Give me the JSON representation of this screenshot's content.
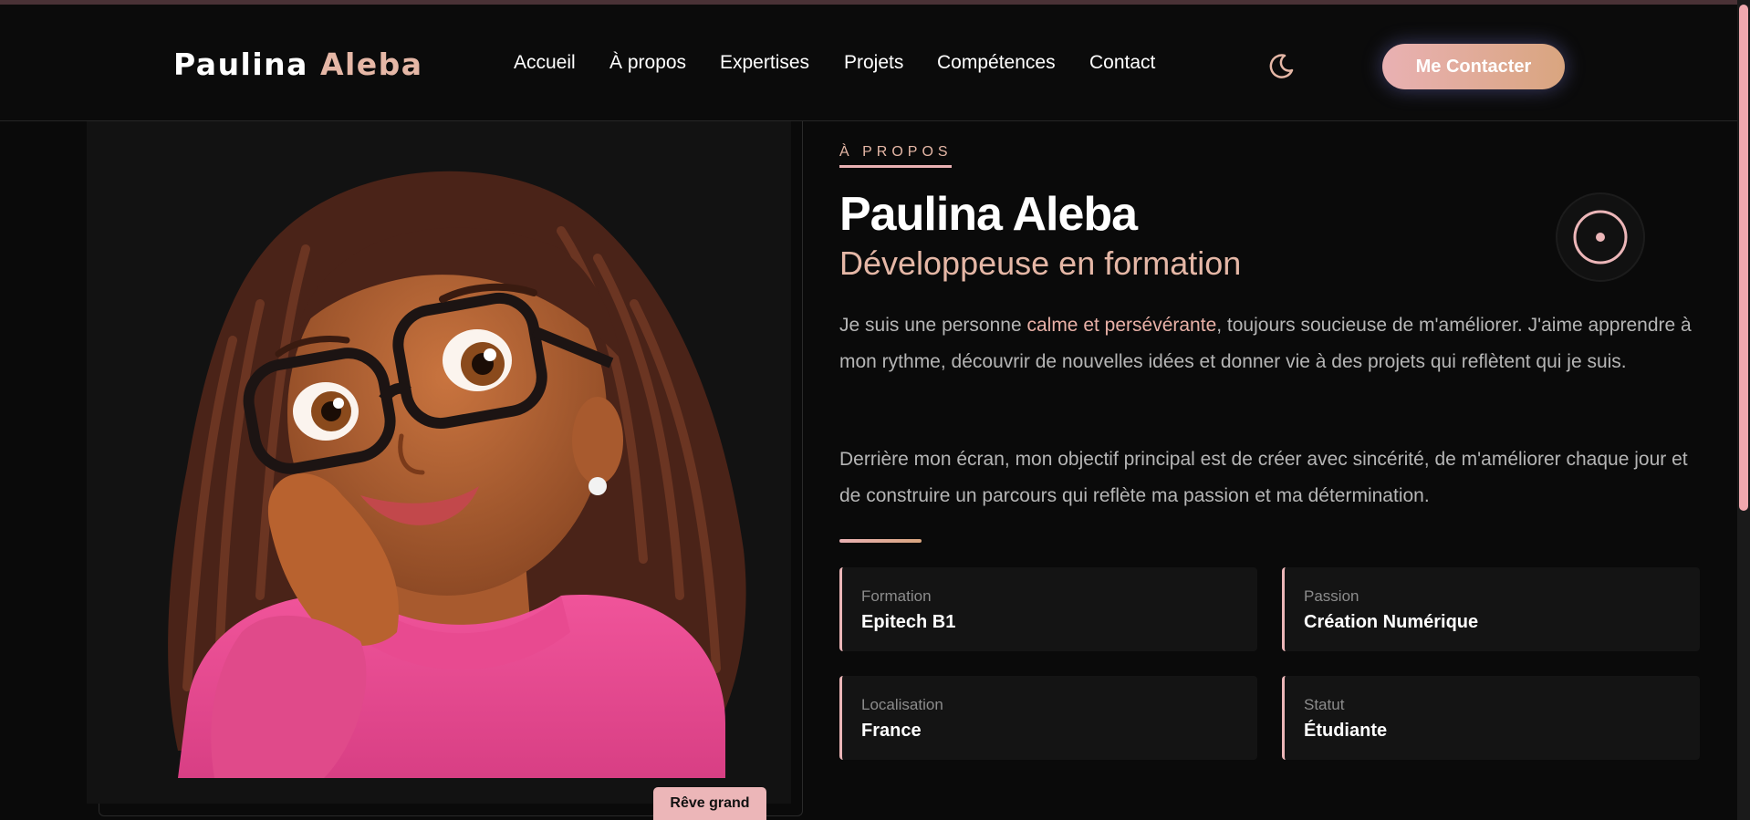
{
  "header": {
    "logo_first": "Paulina",
    "logo_second": "Aleba",
    "nav": [
      "Accueil",
      "À propos",
      "Expertises",
      "Projets",
      "Compétences",
      "Contact"
    ],
    "theme_icon": "moon-icon",
    "cta_label": "Me Contacter"
  },
  "image_card": {
    "badge": "Rêve grand"
  },
  "about": {
    "eyebrow": "À PROPOS",
    "name": "Paulina Aleba",
    "role": "Développeuse en formation",
    "p1_a": "Je suis une personne ",
    "p1_hl": "calme et persévérante",
    "p1_b": ", toujours soucieuse de m'améliorer. J'aime apprendre à mon rythme, découvrir de nouvelles idées et donner vie à des projets qui reflètent qui je suis.",
    "p2": "Derrière mon écran, mon objectif principal est de créer avec sincérité, de m'améliorer chaque jour et de construire un parcours qui reflète ma passion et ma détermination.",
    "target_icon": "target-icon",
    "cards": [
      {
        "label": "Formation",
        "value": "Epitech B1"
      },
      {
        "label": "Passion",
        "value": "Création Numérique"
      },
      {
        "label": "Localisation",
        "value": "France"
      },
      {
        "label": "Statut",
        "value": "Étudiante"
      }
    ]
  },
  "colors": {
    "accent": "#e5b7a6",
    "accent_pink": "#ecb6b8",
    "background": "#0a0a0a",
    "card": "#141414"
  }
}
